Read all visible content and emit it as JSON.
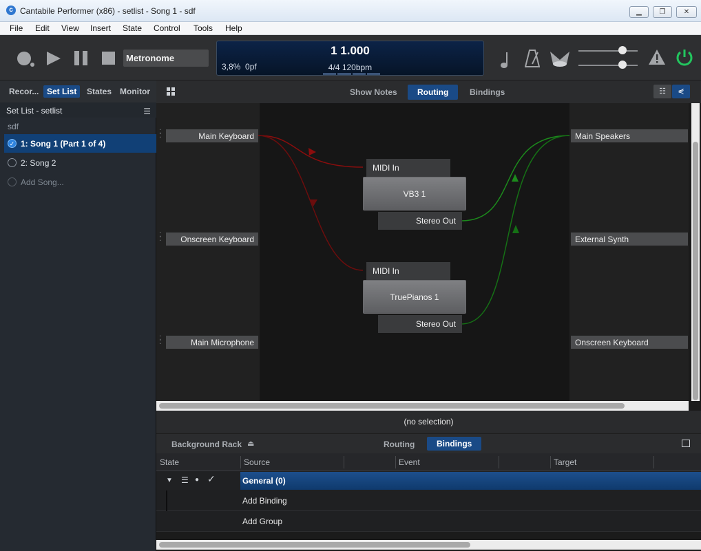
{
  "window": {
    "title": "Cantabile Performer (x86) - setlist - Song 1 - sdf",
    "icon": "cantabile-logo-icon",
    "controls": [
      "minimize-icon",
      "restore-icon",
      "close-icon"
    ]
  },
  "menu": [
    "File",
    "Edit",
    "View",
    "Insert",
    "State",
    "Control",
    "Tools",
    "Help"
  ],
  "transport": {
    "buttons": [
      "record-icon",
      "play-icon",
      "pause-icon",
      "stop-icon"
    ],
    "metronome_label": "Metronome",
    "position": "1 1.000",
    "cpu": "3,8%",
    "load": "0pf",
    "time_sig_tempo": "4/4 120bpm",
    "right_icons": [
      "note-icon",
      "metronome-icon",
      "sound-on-icon",
      "master-level-slider",
      "input-level-slider",
      "warning-icon",
      "power-icon"
    ],
    "power_color": "#22c55e"
  },
  "left": {
    "tabs": [
      "Recor...",
      "Set List",
      "States",
      "Monitor"
    ],
    "active_tab": "Set List",
    "header": "Set List - setlist",
    "setlist_name": "sdf",
    "songs": [
      {
        "label": "1: Song 1 (Part 1 of 4)",
        "checked": true
      },
      {
        "label": "2: Song 2",
        "checked": false
      }
    ],
    "add_song": "Add Song..."
  },
  "main": {
    "tabs": [
      "Show Notes",
      "Routing",
      "Bindings"
    ],
    "active_tab": "Routing"
  },
  "routing": {
    "inputs": [
      "Main Keyboard",
      "Onscreen Keyboard",
      "Main Microphone"
    ],
    "outputs": [
      "Main Speakers",
      "External Synth",
      "Onscreen Keyboard"
    ],
    "plugins": [
      {
        "name": "VB3 1",
        "in": "MIDI In",
        "out": "Stereo Out"
      },
      {
        "name": "TruePianos 1",
        "in": "MIDI In",
        "out": "Stereo Out"
      }
    ],
    "midi_color": "#8b0d0d",
    "audio_color": "#1c8a1c"
  },
  "selection": "(no selection)",
  "lower": {
    "rack_label": "Background Rack",
    "tabs": [
      "Routing",
      "Bindings"
    ],
    "active_tab": "Bindings",
    "columns": [
      "State",
      "Source",
      "Event",
      "Target"
    ],
    "group": "General (0)",
    "rows": [
      "Add Binding",
      "Add Group"
    ]
  }
}
